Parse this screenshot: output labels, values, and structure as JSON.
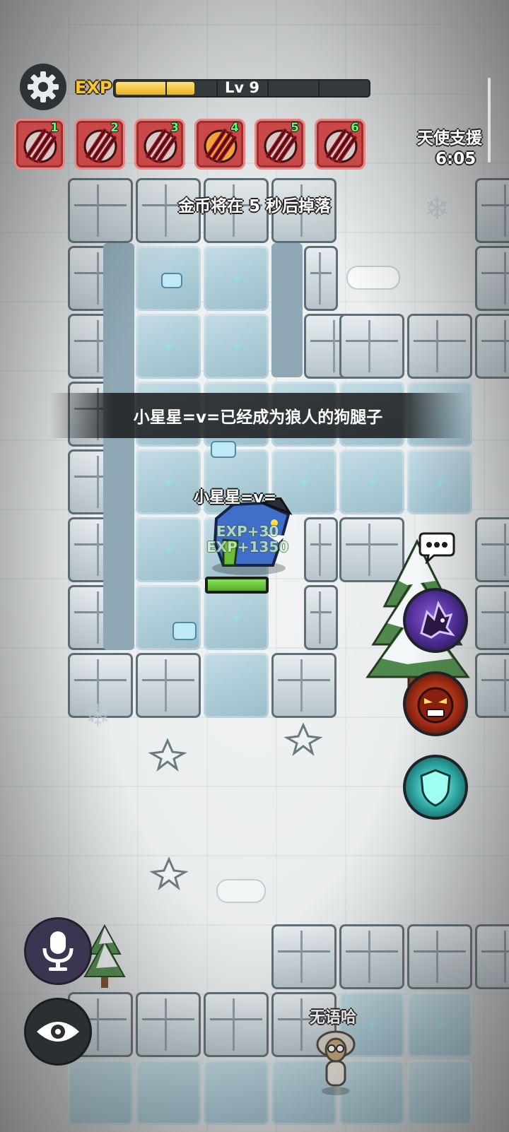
{
  "hud": {
    "exp_label": "EXP",
    "level_text": "Lv 9",
    "exp_progress": 0.32,
    "skills": [
      {
        "number": "1",
        "icon": "claw-slash-icon"
      },
      {
        "number": "2",
        "icon": "claw-slash-icon"
      },
      {
        "number": "3",
        "icon": "claw-slash-icon"
      },
      {
        "number": "4",
        "icon": "fire-claw-slash-icon"
      },
      {
        "number": "5",
        "icon": "claw-slash-icon"
      },
      {
        "number": "6",
        "icon": "claw-slash-icon"
      }
    ]
  },
  "angel_support": {
    "title": "天使支援",
    "timer": "6:05"
  },
  "messages": {
    "coin_drop": "金币将在 5 秒后掉落",
    "announcement": "小星星=v=已经成为狼人的狗腿子"
  },
  "player": {
    "name": "小星星=v=",
    "exp_gain_1": "EXP+30",
    "exp_gain_2": "EXP+1350",
    "hp_fraction": 1.0
  },
  "other_player": {
    "name": "无语哈"
  },
  "abilities": [
    {
      "icon": "wolf-howl-icon"
    },
    {
      "icon": "rage-face-icon"
    },
    {
      "icon": "shield-icon"
    }
  ],
  "controls": {
    "settings_icon": "gear-icon",
    "voice_icon": "microphone-icon",
    "view_icon": "eye-icon",
    "chat_icon": "chat-bubble-icon"
  },
  "colors": {
    "exp_fill": "#eab21d",
    "skill_slot": "#c94848",
    "hp_fill": "#4fae2b",
    "ice": "#a9c9d5"
  }
}
